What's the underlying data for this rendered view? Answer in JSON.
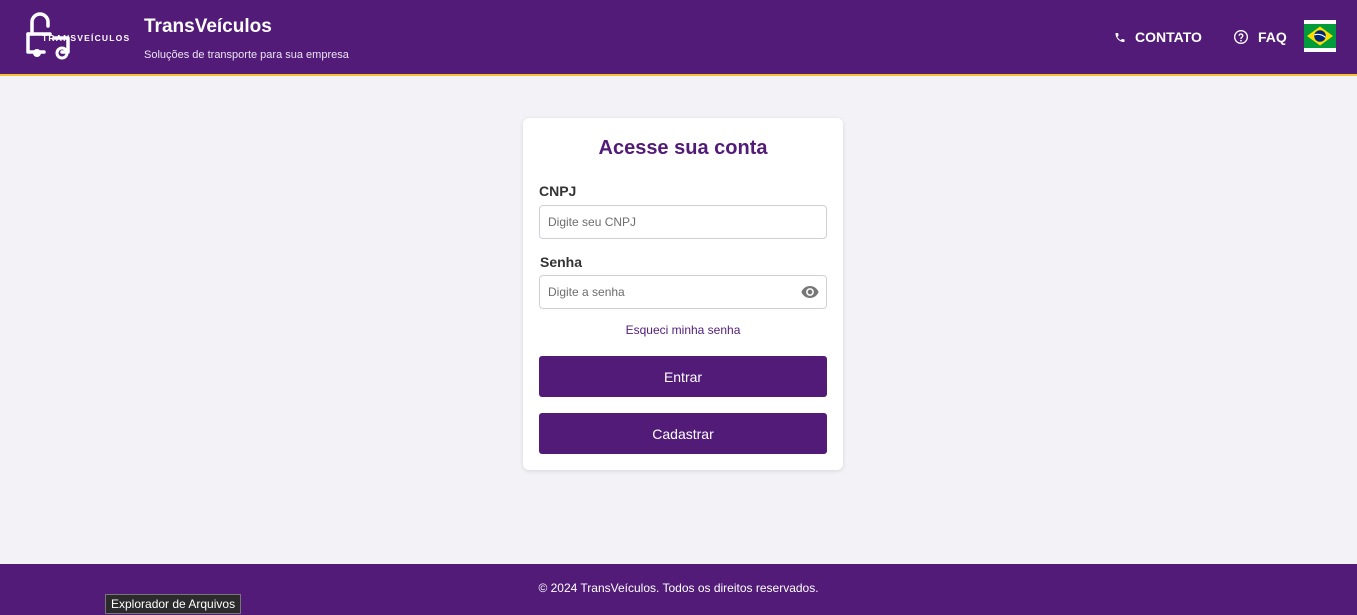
{
  "header": {
    "logo_text": "TRANSVEÍCULOS",
    "title": "TransVeículos",
    "subtitle": "Soluções de transporte para sua empresa",
    "nav": {
      "contato_label": "CONTATO",
      "contato_icon": "phone-icon",
      "faq_label": "FAQ",
      "faq_icon": "question-circle-icon",
      "language_flag": "brazil-flag"
    }
  },
  "login": {
    "title": "Acesse sua conta",
    "cnpj_label": "CNPJ",
    "cnpj_placeholder": "Digite seu CNPJ",
    "cnpj_value": "",
    "senha_label": "Senha",
    "senha_placeholder": "Digite a senha",
    "senha_value": "",
    "show_password_icon": "eye-icon",
    "forgot_link": "Esqueci minha senha",
    "login_button": "Entrar",
    "register_button": "Cadastrar"
  },
  "footer": {
    "text": "© 2024 TransVeículos. Todos os direitos reservados."
  },
  "tooltip": {
    "text": "Explorador de Arquivos"
  },
  "colors": {
    "primary": "#521b78",
    "accent": "#f2c230",
    "background": "#f3f2f7"
  }
}
